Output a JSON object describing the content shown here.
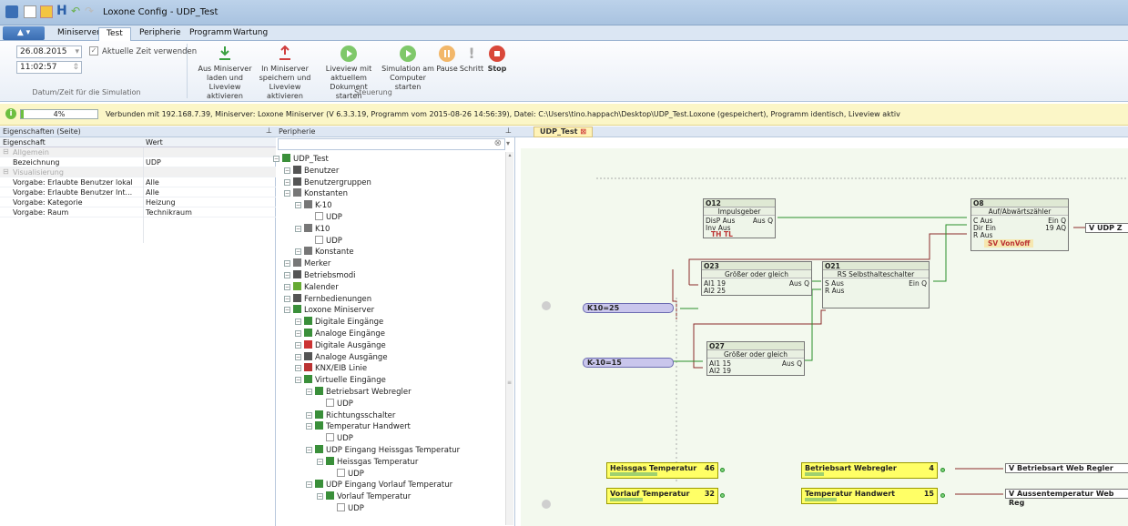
{
  "window": {
    "title": "Loxone Config - UDP_Test"
  },
  "menu": {
    "app_button": "",
    "tabs": [
      "Miniserver",
      "Test",
      "Peripherie",
      "Programm",
      "Wartung"
    ],
    "active": "Test"
  },
  "ribbon": {
    "date_value": "26.08.2015",
    "time_value": "11:02:57",
    "use_current_time": "Aktuelle Zeit verwenden",
    "group_sim_time": "Datum/Zeit für die Simulation",
    "btn_load": "Aus Miniserver laden und Liveview aktivieren",
    "btn_save": "In Miniserver speichern und Liveview aktivieren",
    "btn_liveview": "Liveview mit aktuellem Dokument starten",
    "btn_sim": "Simulation am Computer starten",
    "group_control": "Steuerung",
    "btn_pause": "Pause",
    "btn_step": "Schritt",
    "btn_stop": "Stop"
  },
  "status": {
    "progress": "4%",
    "progress_value": 0.04,
    "text": "Verbunden mit 192.168.7.39, Miniserver: Loxone Miniserver (V 6.3.3.19, Programm vom 2015-08-26 14:56:39), Datei: C:\\Users\\tino.happach\\Desktop\\UDP_Test.Loxone (gespeichert), Programm identisch, Liveview aktiv"
  },
  "panels": {
    "props_title": "Eigenschaften (Seite)",
    "periph_title": "Peripherie",
    "canvas_tab": "UDP_Test"
  },
  "properties": {
    "col_prop": "Eigenschaft",
    "col_value": "Wert",
    "rows": [
      {
        "name": "Allgemein",
        "value": "",
        "section": true
      },
      {
        "name": "Bezeichnung",
        "value": "UDP"
      },
      {
        "name": "Visualisierung",
        "value": "",
        "section": true
      },
      {
        "name": "Vorgabe: Erlaubte Benutzer lokal",
        "value": "Alle"
      },
      {
        "name": "Vorgabe: Erlaubte Benutzer Int...",
        "value": "Alle"
      },
      {
        "name": "Vorgabe: Kategorie",
        "value": "Heizung"
      },
      {
        "name": "Vorgabe: Raum",
        "value": "Technikraum"
      }
    ]
  },
  "tree": [
    {
      "label": "UDP_Test",
      "level": 0,
      "icon": "project-icon",
      "color": "#3a8f3a"
    },
    {
      "label": "Benutzer",
      "level": 1,
      "icon": "user-icon",
      "color": "#555"
    },
    {
      "label": "Benutzergruppen",
      "level": 1,
      "icon": "users-icon",
      "color": "#555"
    },
    {
      "label": "Konstanten",
      "level": 1,
      "icon": "constant-icon",
      "color": "#777"
    },
    {
      "label": "K-10",
      "level": 2,
      "icon": "constant-icon",
      "color": "#777"
    },
    {
      "label": "UDP",
      "level": 3,
      "icon": "page-icon",
      "color": "#999"
    },
    {
      "label": "K10",
      "level": 2,
      "icon": "constant-icon",
      "color": "#777"
    },
    {
      "label": "UDP",
      "level": 3,
      "icon": "page-icon",
      "color": "#999"
    },
    {
      "label": "Konstante",
      "level": 2,
      "icon": "constant-icon",
      "color": "#777"
    },
    {
      "label": "Merker",
      "level": 1,
      "icon": "marker-icon",
      "color": "#777"
    },
    {
      "label": "Betriebsmodi",
      "level": 1,
      "icon": "clock-icon",
      "color": "#555"
    },
    {
      "label": "Kalender",
      "level": 1,
      "icon": "calendar-icon",
      "color": "#6a3"
    },
    {
      "label": "Fernbedienungen",
      "level": 1,
      "icon": "remote-icon",
      "color": "#555"
    },
    {
      "label": "Loxone Miniserver",
      "level": 1,
      "icon": "miniserver-icon",
      "color": "#3a8f3a"
    },
    {
      "label": "Digitale Eingänge",
      "level": 2,
      "icon": "digital-in-icon",
      "color": "#3a8f3a"
    },
    {
      "label": "Analoge Eingänge",
      "level": 2,
      "icon": "analog-in-icon",
      "color": "#3a8f3a"
    },
    {
      "label": "Digitale Ausgänge",
      "level": 2,
      "icon": "digital-out-icon",
      "color": "#c33"
    },
    {
      "label": "Analoge Ausgänge",
      "level": 2,
      "icon": "analog-out-icon",
      "color": "#555"
    },
    {
      "label": "KNX/EIB Linie",
      "level": 2,
      "icon": "knx-icon",
      "color": "#b33"
    },
    {
      "label": "Virtuelle Eingänge",
      "level": 2,
      "icon": "virtual-in-icon",
      "color": "#3a8f3a"
    },
    {
      "label": "Betriebsart Webregler",
      "level": 3,
      "icon": "virtual-input-icon",
      "color": "#3a8f3a"
    },
    {
      "label": "UDP",
      "level": 4,
      "icon": "page-icon",
      "color": "#999"
    },
    {
      "label": "Richtungsschalter",
      "level": 3,
      "icon": "virtual-input-icon",
      "color": "#3a8f3a"
    },
    {
      "label": "Temperatur Handwert",
      "level": 3,
      "icon": "virtual-input-icon",
      "color": "#3a8f3a"
    },
    {
      "label": "UDP",
      "level": 4,
      "icon": "page-icon",
      "color": "#999"
    },
    {
      "label": "UDP Eingang Heissgas Temperatur",
      "level": 3,
      "icon": "udp-input-icon",
      "color": "#3a8f3a"
    },
    {
      "label": "Heissgas Temperatur",
      "level": 4,
      "icon": "virtual-input-icon",
      "color": "#3a8f3a"
    },
    {
      "label": "UDP",
      "level": 5,
      "icon": "page-icon",
      "color": "#999"
    },
    {
      "label": "UDP Eingang Vorlauf Temperatur",
      "level": 3,
      "icon": "udp-input-icon",
      "color": "#3a8f3a"
    },
    {
      "label": "Vorlauf Temperatur",
      "level": 4,
      "icon": "virtual-input-icon",
      "color": "#3a8f3a"
    },
    {
      "label": "UDP",
      "level": 5,
      "icon": "page-icon",
      "color": "#999"
    }
  ],
  "blocks": {
    "o12": {
      "id": "O12",
      "name": "Impulsgeber",
      "in": [
        "DisP Aus",
        "Inv Aus"
      ],
      "out": "Aus Q",
      "params": "TH TL"
    },
    "o8": {
      "id": "O8",
      "name": "Auf/Abwärtszähler",
      "in": [
        "C Aus",
        "Dir Ein",
        "R Aus"
      ],
      "out1": "Ein Q",
      "out2": "19 AQ",
      "params": "SV VonVoff",
      "output_label": "V UDP Z"
    },
    "o23": {
      "id": "O23",
      "name": "Größer oder gleich",
      "in": [
        "AI1 19",
        "AI2 25"
      ],
      "out": "Aus Q"
    },
    "o21": {
      "id": "O21",
      "name": "RS Selbsthalteschalter",
      "in": [
        "S Aus",
        "R Aus"
      ],
      "out": "Ein Q"
    },
    "o27": {
      "id": "O27",
      "name": "Größer oder gleich",
      "in": [
        "AI1 15",
        "AI2 19"
      ],
      "out": "Aus Q"
    }
  },
  "constants": {
    "k1": "K10=25",
    "k2": "K-10=15"
  },
  "virtual_inputs": [
    {
      "name": "Heissgas Temperatur",
      "value": "46",
      "level": 0.46
    },
    {
      "name": "Vorlauf Temperatur",
      "value": "32",
      "level": 0.32
    },
    {
      "name": "Betriebsart Webregler",
      "value": "4",
      "level": 0.15
    },
    {
      "name": "Temperatur Handwert",
      "value": "15",
      "level": 0.25
    }
  ],
  "virtual_outputs": {
    "o1": "V  Betriebsart Web Regler",
    "o2": "V  Aussentemperatur Web Reg"
  }
}
